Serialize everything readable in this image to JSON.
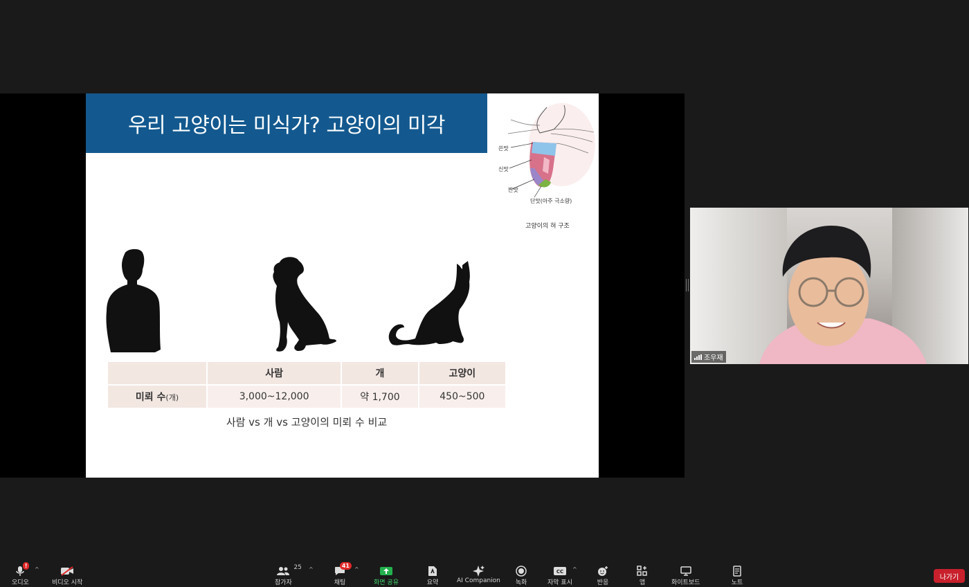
{
  "slide": {
    "title": "우리 고양이는 미식가? 고양이의 미각",
    "diagram": {
      "labels": [
        "쓴맛",
        "신맛",
        "짠맛",
        "단맛(아주 극소량)"
      ],
      "caption": "고양이의 혀 구조"
    },
    "table": {
      "headers": [
        "",
        "사람",
        "개",
        "고양이"
      ],
      "row_label": "미뢰 수",
      "row_label_unit": "(개)",
      "values": [
        "3,000~12,000",
        "약 1,700",
        "450~500"
      ]
    },
    "caption": "사람 vs 개 vs 고양이의 미뢰 수 비교"
  },
  "video": {
    "participant_name": "조우재"
  },
  "toolbar": {
    "audio_label": "오디오",
    "video_label": "비디오 시작",
    "participants_label": "참가자",
    "participants_count": "25",
    "chat_label": "채팅",
    "chat_badge": "41",
    "share_label": "화면 공유",
    "summary_label": "요약",
    "ai_label": "AI Companion",
    "record_label": "녹화",
    "captions_label": "자막 표시",
    "reactions_label": "반응",
    "apps_label": "앱",
    "whiteboard_label": "화이트보드",
    "notes_label": "노트",
    "leave_label": "나가기"
  },
  "colors": {
    "header_blue": "#13598f",
    "share_green": "#23b14d",
    "leave_red": "#c8202c",
    "badge_red": "#e02828"
  }
}
